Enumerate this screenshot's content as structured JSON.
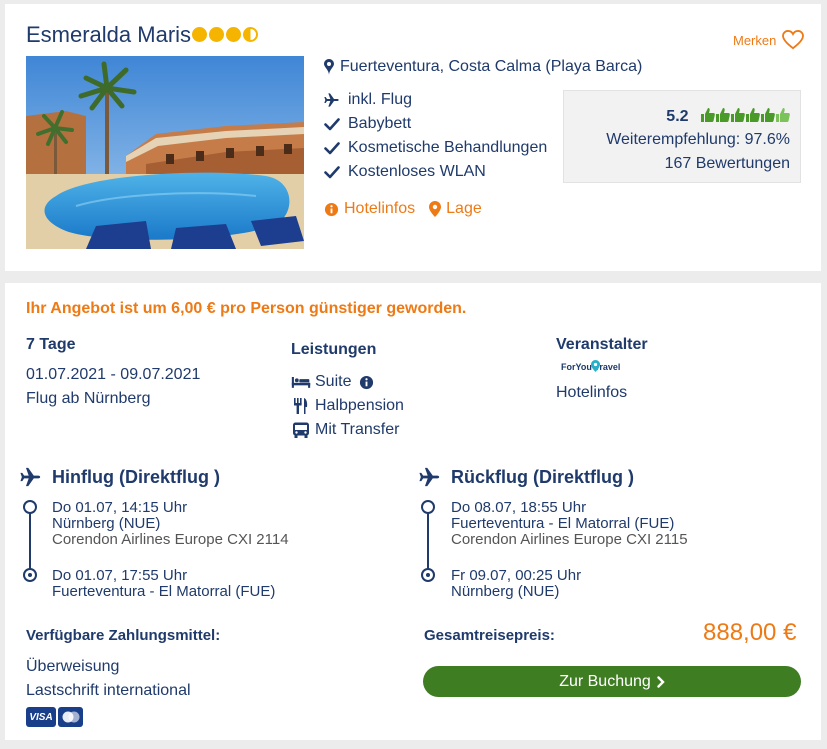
{
  "hotel": {
    "name": "Esmeralda Maris",
    "star_rating": 3.5,
    "merken_label": "Merken",
    "location": "Fuerteventura, Costa Calma (Playa Barca)",
    "features": [
      {
        "icon": "plane-icon",
        "label": "inkl. Flug"
      },
      {
        "icon": "check-icon",
        "label": "Babybett"
      },
      {
        "icon": "check-icon",
        "label": "Kosmetische Behandlungen"
      },
      {
        "icon": "check-icon",
        "label": "Kostenloses WLAN"
      }
    ],
    "hotelinfos_label": "Hotelinfos",
    "lage_label": "Lage",
    "rating": {
      "score": "5.2",
      "thumbs": 6,
      "recommendation": "Weiterempfehlung: 97.6%",
      "reviews": "167 Bewertungen"
    }
  },
  "offer": {
    "cheaper_notice": "Ihr Angebot ist um 6,00 € pro Person günstiger geworden.",
    "duration": "7 Tage",
    "dates": "01.07.2021 - 09.07.2021",
    "departure": "Flug ab Nürnberg",
    "services_title": "Leistungen",
    "services": {
      "room": "Suite",
      "board": "Halbpension",
      "transfer": "Mit Transfer"
    },
    "operator_title": "Veranstalter",
    "operator_logo": "ForYou Travel",
    "operator_link": "Hotelinfos",
    "outbound": {
      "title": "Hinflug (Direktflug )",
      "dep_time": "Do 01.07, 14:15 Uhr",
      "dep_airport": "Nürnberg (NUE)",
      "airline": "Corendon Airlines Europe CXI 2114",
      "arr_time": "Do 01.07, 17:55 Uhr",
      "arr_airport": "Fuerteventura - El Matorral (FUE)"
    },
    "return": {
      "title": "Rückflug (Direktflug )",
      "dep_time": "Do 08.07, 18:55 Uhr",
      "dep_airport": "Fuerteventura - El Matorral (FUE)",
      "airline": "Corendon Airlines Europe CXI 2115",
      "arr_time": "Fr 09.07, 00:25 Uhr",
      "arr_airport": "Nürnberg (NUE)"
    },
    "payment_title": "Verfügbare Zahlungsmittel:",
    "payment_methods": [
      "Überweisung",
      "Lastschrift international"
    ],
    "payment_cards": [
      "VISA",
      "Mastercard"
    ],
    "total_label": "Gesamtreisepreis:",
    "total_price": "888,00 €",
    "book_label": "Zur Buchung"
  },
  "colors": {
    "brand_blue": "#1f3a6b",
    "accent_orange": "#ee7a16",
    "book_green": "#3f7d23",
    "star_yellow": "#f4b400",
    "thumb_green": "#4a9a2a"
  }
}
